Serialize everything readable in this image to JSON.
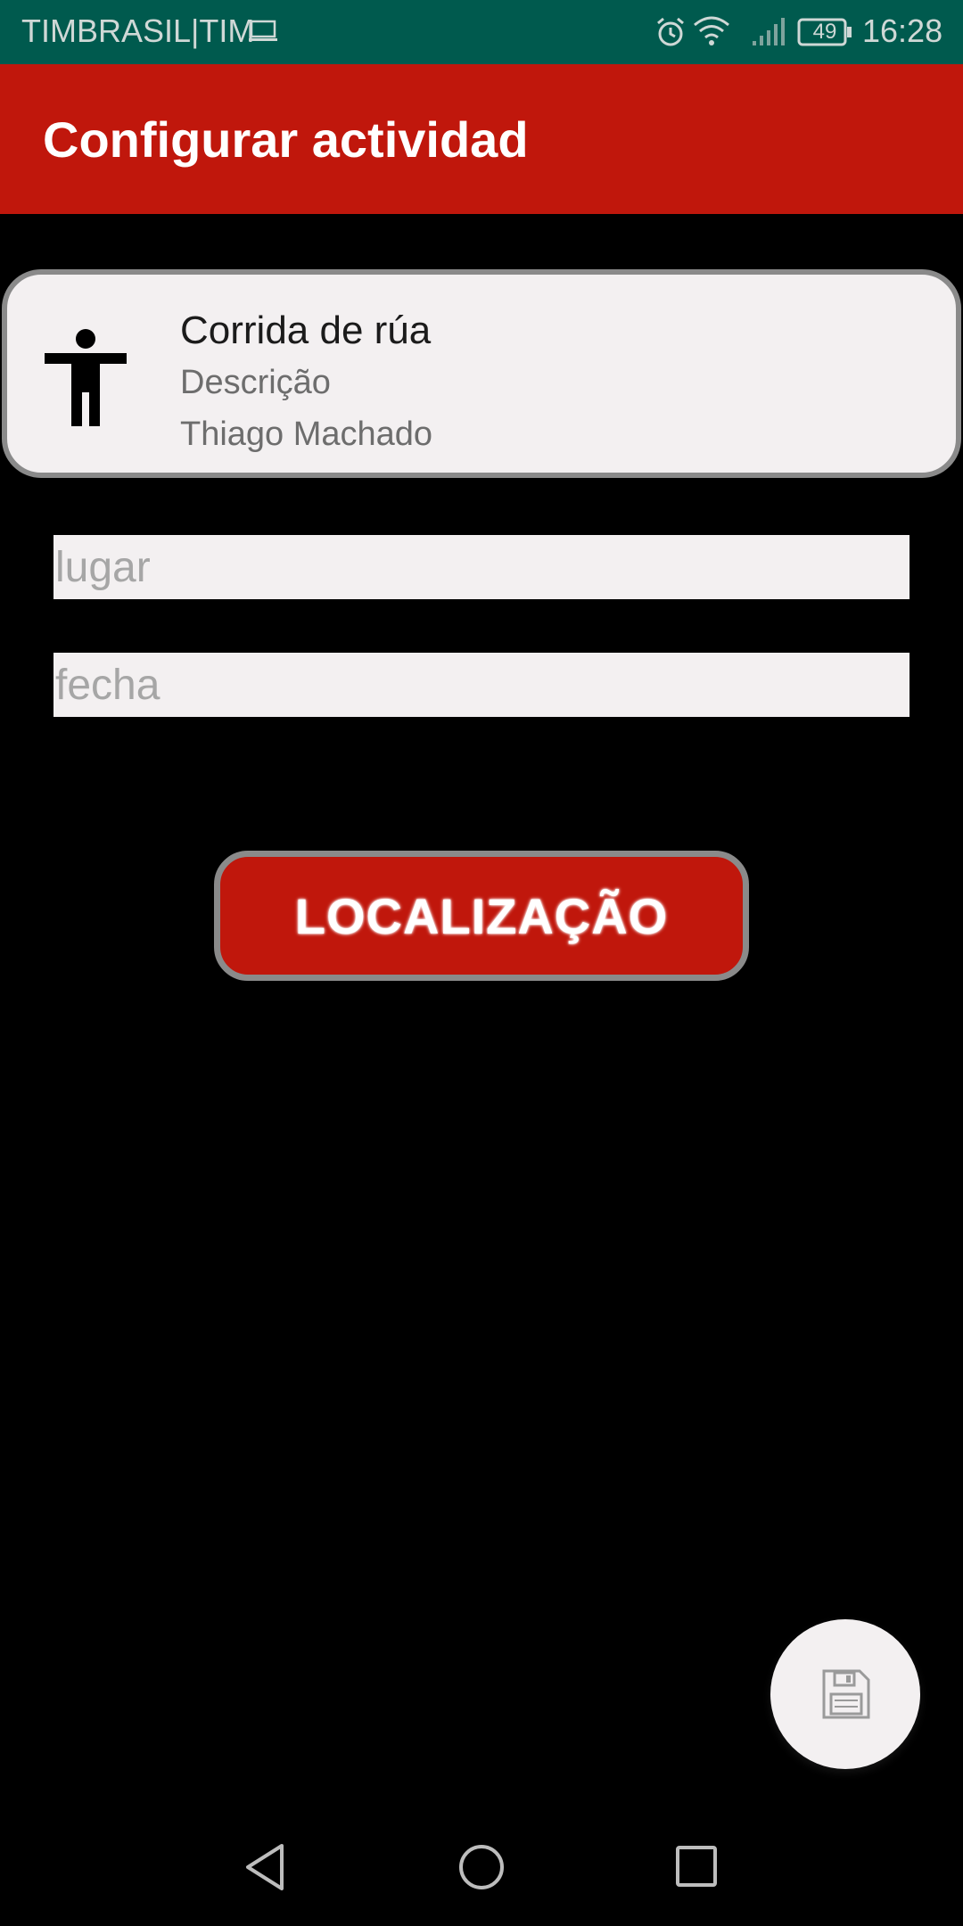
{
  "status_bar": {
    "carrier": "TIMBRASIL|TIM",
    "battery": "49",
    "time": "16:28",
    "icons": [
      "laptop-icon",
      "alarm-icon",
      "wifi-icon",
      "signal-icon",
      "battery-icon"
    ]
  },
  "app_bar": {
    "title": "Configurar actividad",
    "color": "#c0170c"
  },
  "activity_card": {
    "icon": "person-icon",
    "title": "Corrida de rúa",
    "description": "Descrição",
    "author": "Thiago Machado"
  },
  "form": {
    "lugar_placeholder": "lugar",
    "lugar_value": "",
    "fecha_placeholder": "fecha",
    "fecha_value": ""
  },
  "location_button": {
    "label": "LOCALIZAÇÃO",
    "color": "#c0170c"
  },
  "fab": {
    "icon": "save-icon"
  },
  "nav": {
    "icons": [
      "back-icon",
      "home-icon",
      "recents-icon"
    ]
  }
}
